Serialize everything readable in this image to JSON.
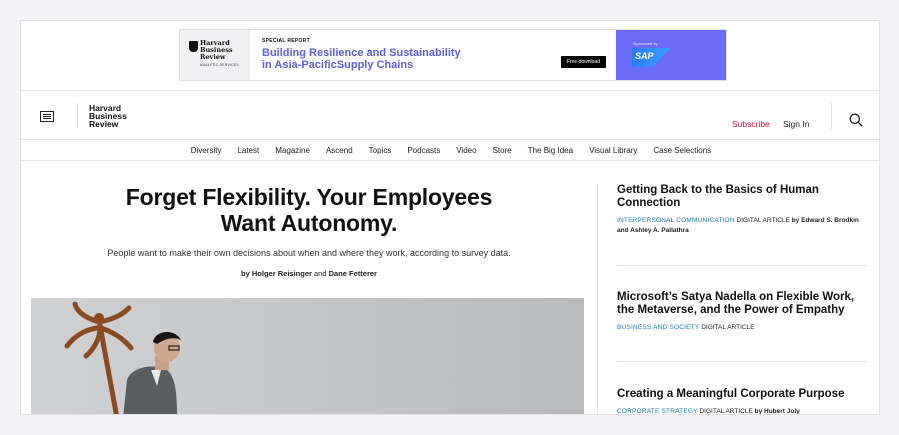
{
  "ad": {
    "logo_name": "Harvard Business Review",
    "logo_sub": "ANALYTIC SERVICES",
    "kicker": "SPECIAL REPORT",
    "headline": "Building Resilience and Sustainability in Asia-PacificSupply Chains",
    "cta": "Free download",
    "sponsored_label": "Sponsored by",
    "sponsor_name": "SAP",
    "brand_color": "#6a6cf5",
    "headline_color": "#5b5ef0"
  },
  "header": {
    "menu_icon": "menu-icon",
    "logo_text": "Harvard Business Review",
    "subscribe_label": "Subscribe",
    "signin_label": "Sign In",
    "search_icon": "search-icon",
    "accent_color": "#c8102e"
  },
  "nav": {
    "items": [
      "Diversity",
      "Latest",
      "Magazine",
      "Ascend",
      "Topics",
      "Podcasts",
      "Video",
      "Store",
      "The Big Idea",
      "Visual Library",
      "Case Selections"
    ]
  },
  "main_story": {
    "headline": "Forget Flexibility. Your Employees Want Autonomy.",
    "dek": "People want to make their own decisions about when and where they work, according to survey data.",
    "byline_prefix": "by",
    "author_1": "Holger Reisinger",
    "byline_and": "and",
    "author_2": "Dane Fetterer"
  },
  "sidebar": {
    "topic_color": "#1b7ab8",
    "items": [
      {
        "title": "Getting Back to the Basics of Human Connection",
        "topic": "INTERPERSONAL COMMUNICATION",
        "type": "DIGITAL ARTICLE",
        "byline": "by Edward S. Brodkin and Ashley A. Pallathra"
      },
      {
        "title": "Microsoft’s Satya Nadella on Flexible Work, the Metaverse, and the Power of Empathy",
        "topic": "BUSINESS AND SOCIETY",
        "type": "DIGITAL ARTICLE",
        "byline": ""
      },
      {
        "title": "Creating a Meaningful Corporate Purpose",
        "topic": "CORPORATE STRATEGY",
        "type": "DIGITAL ARTICLE",
        "byline": "by Hubert Joly"
      }
    ]
  }
}
